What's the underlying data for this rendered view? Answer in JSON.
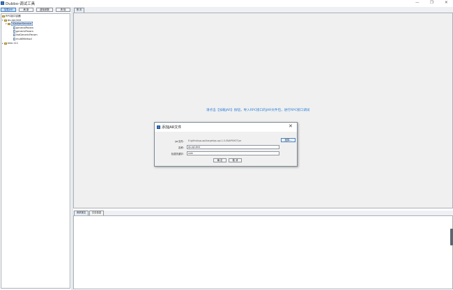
{
  "window": {
    "title": "Dubbo-调试工具",
    "minimize": "—",
    "maximize": "❐",
    "close": "✕"
  },
  "toolbar": {
    "buttons": [
      {
        "label": "加载JAR"
      },
      {
        "label": "刷 新"
      },
      {
        "label": "虚拟参数"
      },
      {
        "label": "清 除"
      }
    ]
  },
  "tree": {
    "root": "RPC接口容器",
    "nodes": [
      {
        "label": "qs-api-test"
      },
      {
        "label": "IQsUserService"
      },
      {
        "label": "generalParam"
      },
      {
        "label": "genericParam"
      },
      {
        "label": "listGenericParam"
      },
      {
        "label": "multiMethod"
      },
      {
        "label": "test-111"
      }
    ]
  },
  "main": {
    "tab_label": "首 页",
    "hint": "请点击【加载JAR】按钮，导入RPC接口的JAR文件包，进行RPC接口调试"
  },
  "bottom": {
    "tabs": [
      {
        "label": "请求报文"
      },
      {
        "label": "日志信息"
      }
    ]
  },
  "dialog": {
    "title": "添加JAR文件",
    "fields": [
      {
        "label": "Jar文件：",
        "value": "E:\\github\\qs-api\\target\\qs-api-1.0-SNAPSHOT.jar"
      },
      {
        "label": "名称：",
        "value": "qs-api-test"
      },
      {
        "label": "包或关键字：",
        "value": "com"
      }
    ],
    "browse_label": "选择...",
    "ok_label": "确 定",
    "cancel_label": "取 消"
  }
}
